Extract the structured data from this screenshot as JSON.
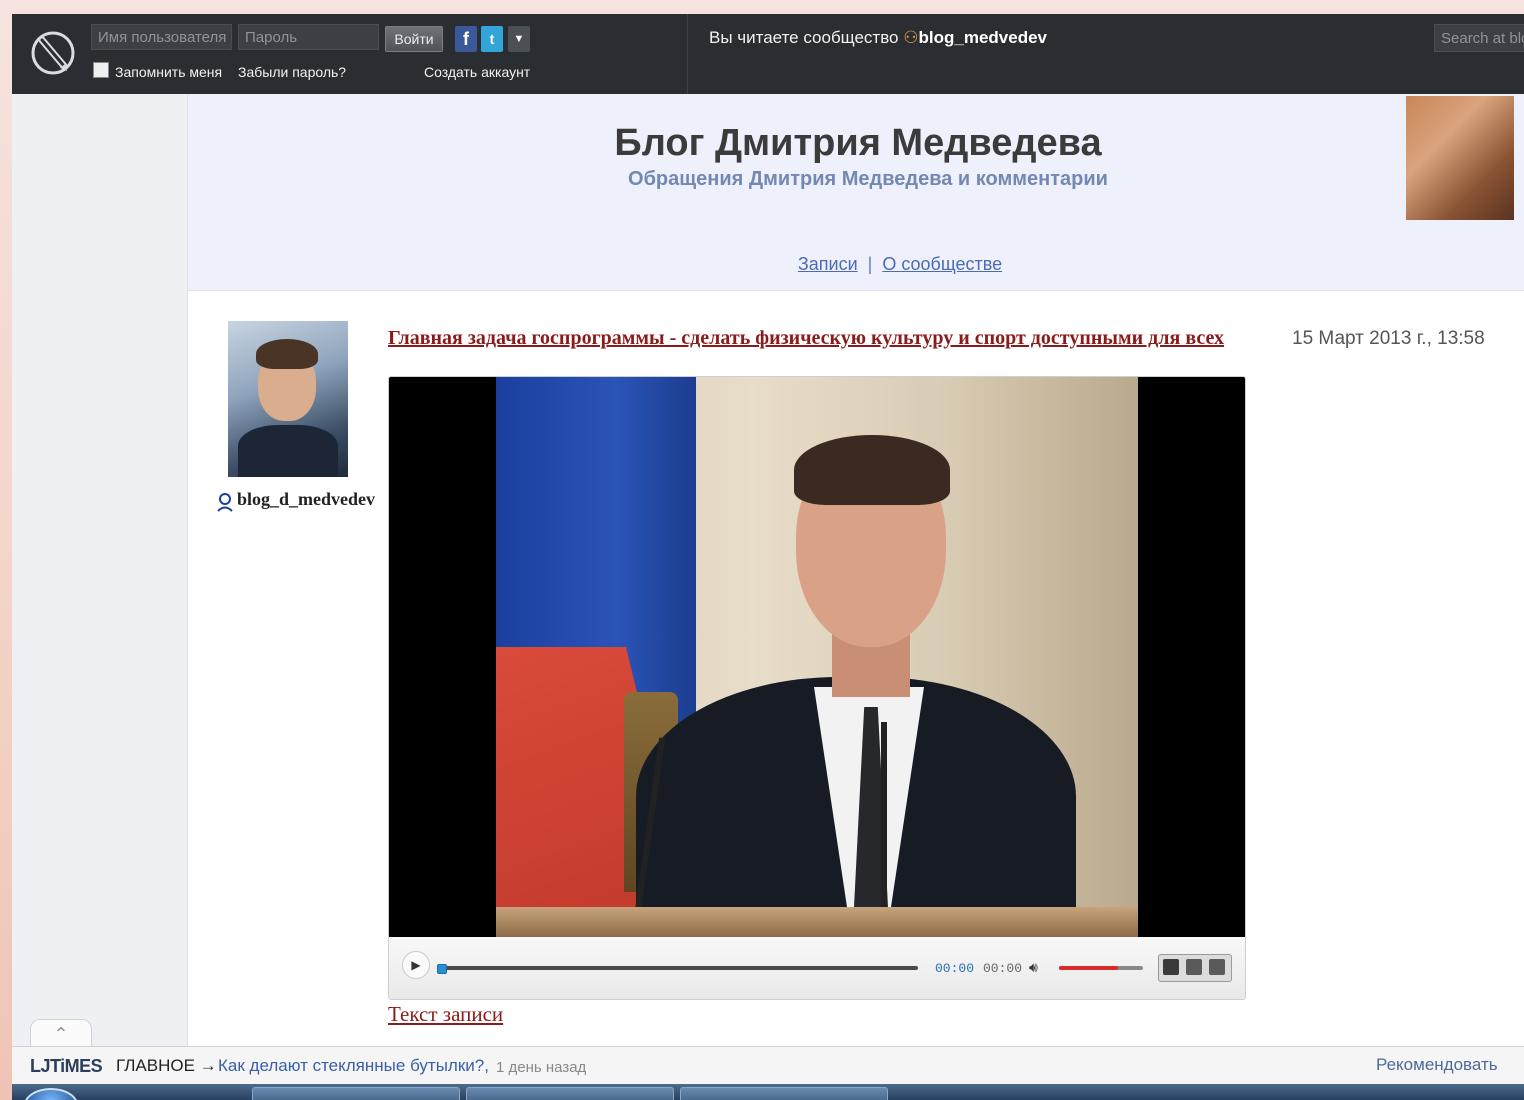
{
  "topbar": {
    "username_placeholder": "Имя пользователя",
    "password_placeholder": "Пароль",
    "login_label": "Войти",
    "remember_label": "Запомнить меня",
    "forgot_label": "Забыли пароль?",
    "create_account_label": "Создать аккаунт",
    "reading_prefix": "Вы читаете сообщество",
    "community_name": "blog_medvedev",
    "search_placeholder": "Search at blo",
    "facebook_icon": "facebook-icon",
    "twitter_icon": "twitter-icon"
  },
  "header": {
    "title": "Блог Дмитрия Медведева",
    "subtitle": "Обращения Дмитрия Медведева и комментарии",
    "nav": [
      {
        "label": "Записи"
      },
      {
        "label": "О сообществе"
      }
    ],
    "nav_separator": "|"
  },
  "post": {
    "author": "blog_d_medvedev",
    "title": "Главная задача госпрограммы - сделать физическую культуру и спорт доступными для всех",
    "date": "15 Март 2013 г., 13:58",
    "text_link": "Текст записи"
  },
  "player": {
    "time_current": "00:00",
    "time_total": "00:00",
    "progress_fraction": 0.0,
    "volume_fraction": 0.7
  },
  "footer": {
    "brand": "LJTiMES",
    "main_label": "ГЛАВНОЕ →",
    "news_link": "Как делают стеклянные бутылки?,",
    "news_age": "1 день назад",
    "recommend_label": "Рекомендовать",
    "scroll_up_icon": "chevron-up-icon"
  },
  "colors": {
    "topbar": "#2a2d31",
    "header_bg": "#eef0fb",
    "post_title": "#8b1a1a",
    "subtitle": "#7388b3",
    "link": "#4d6bb3"
  }
}
